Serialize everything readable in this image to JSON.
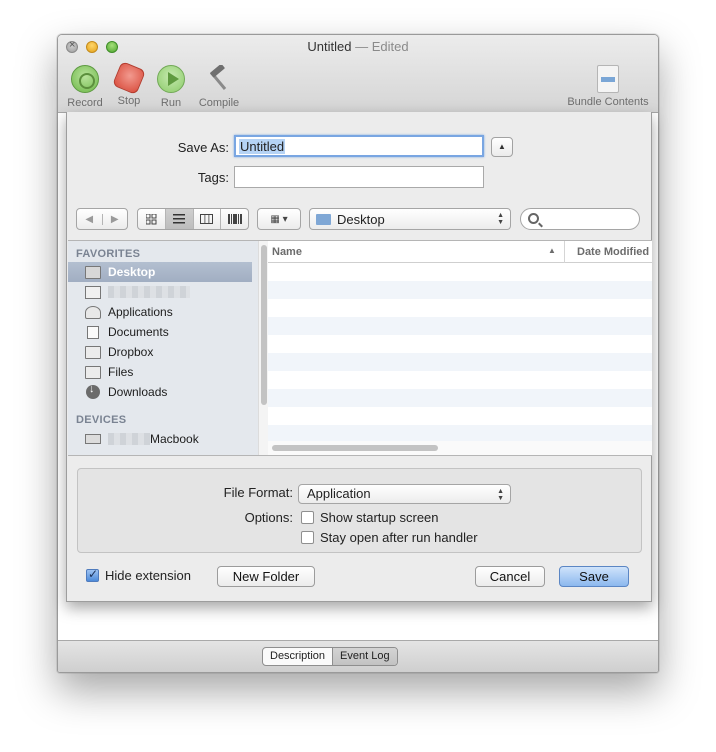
{
  "window": {
    "title": "Untitled",
    "title_suffix": "— Edited"
  },
  "toolbar": {
    "record": "Record",
    "stop": "Stop",
    "run": "Run",
    "compile": "Compile",
    "bundle_contents": "Bundle Contents"
  },
  "sheet": {
    "save_as_label": "Save As:",
    "save_as_value": "Untitled",
    "tags_label": "Tags:",
    "tags_value": "",
    "location": "Desktop",
    "search_value": "",
    "sidebar": {
      "favorites_header": "FAVORITES",
      "devices_header": "DEVICES",
      "favorites": [
        "Desktop",
        "",
        "Applications",
        "Documents",
        "Dropbox",
        "Files",
        "Downloads"
      ],
      "device_suffix": "Macbook"
    },
    "columns": {
      "name": "Name",
      "date_modified": "Date Modified"
    },
    "file_format_label": "File Format:",
    "file_format_value": "Application",
    "options_label": "Options:",
    "option_startup": "Show startup screen",
    "option_stay_open": "Stay open after run handler",
    "hide_extension": "Hide extension",
    "new_folder": "New Folder",
    "cancel": "Cancel",
    "save": "Save"
  },
  "bottom_tabs": {
    "description": "Description",
    "event_log": "Event Log"
  },
  "state": {
    "selected_sidebar_item": "Desktop",
    "view_mode": "list",
    "hide_extension_checked": true,
    "show_startup_checked": false,
    "stay_open_checked": false,
    "active_bottom_tab": "Event Log"
  },
  "colors": {
    "sidebar_selection": "#a9b5c8",
    "default_button": "#8cb8ee",
    "record_green": "#6db748",
    "stop_red": "#d94c3c"
  }
}
